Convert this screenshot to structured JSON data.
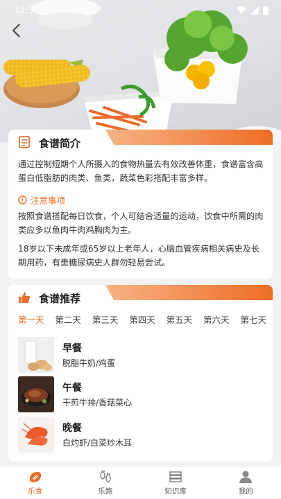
{
  "status_bar": {
    "time": "12:30"
  },
  "intro": {
    "title": "食谱简介",
    "paragraph": "通过控制短期个人所摄入的食物热量去有效改善体重，食谱富含高蛋白低脂肪的肉类、鱼类，蔬菜色彩搭配丰富多样。",
    "notice_label": "注意事项",
    "notice_paragraph": "按照食谱搭配每日饮食，个人可结合适量的运动，饮食中所需的肉类应多以鱼肉牛肉鸡胸肉为主。",
    "warning_paragraph": "18岁以下未成年或65岁以上老年人，心脑血管疾病相关病史及长期用药，有患糖尿病史人群勿轻易尝试。"
  },
  "recipe": {
    "title": "食谱推荐",
    "days": [
      "第一天",
      "第二天",
      "第三天",
      "第四天",
      "第五天",
      "第六天",
      "第七天"
    ],
    "active_day_index": 0,
    "meals": [
      {
        "name": "早餐",
        "desc": "脱脂牛奶/鸡蛋",
        "icon": "milk-eggs-image"
      },
      {
        "name": "午餐",
        "desc": "干煎牛排/香菇菜心",
        "icon": "steak-image"
      },
      {
        "name": "晚餐",
        "desc": "白灼虾/白菜炒木耳",
        "icon": "shrimp-image"
      }
    ]
  },
  "tabbar": {
    "items": [
      {
        "label": "乐食",
        "icon": "food-icon",
        "active": true
      },
      {
        "label": "乐跑",
        "icon": "footprint-icon",
        "active": false
      },
      {
        "label": "知识库",
        "icon": "books-icon",
        "active": false
      },
      {
        "label": "我的",
        "icon": "user-icon",
        "active": false
      }
    ]
  },
  "colors": {
    "accent": "#ef6c24",
    "background": "#f2f2f2"
  }
}
